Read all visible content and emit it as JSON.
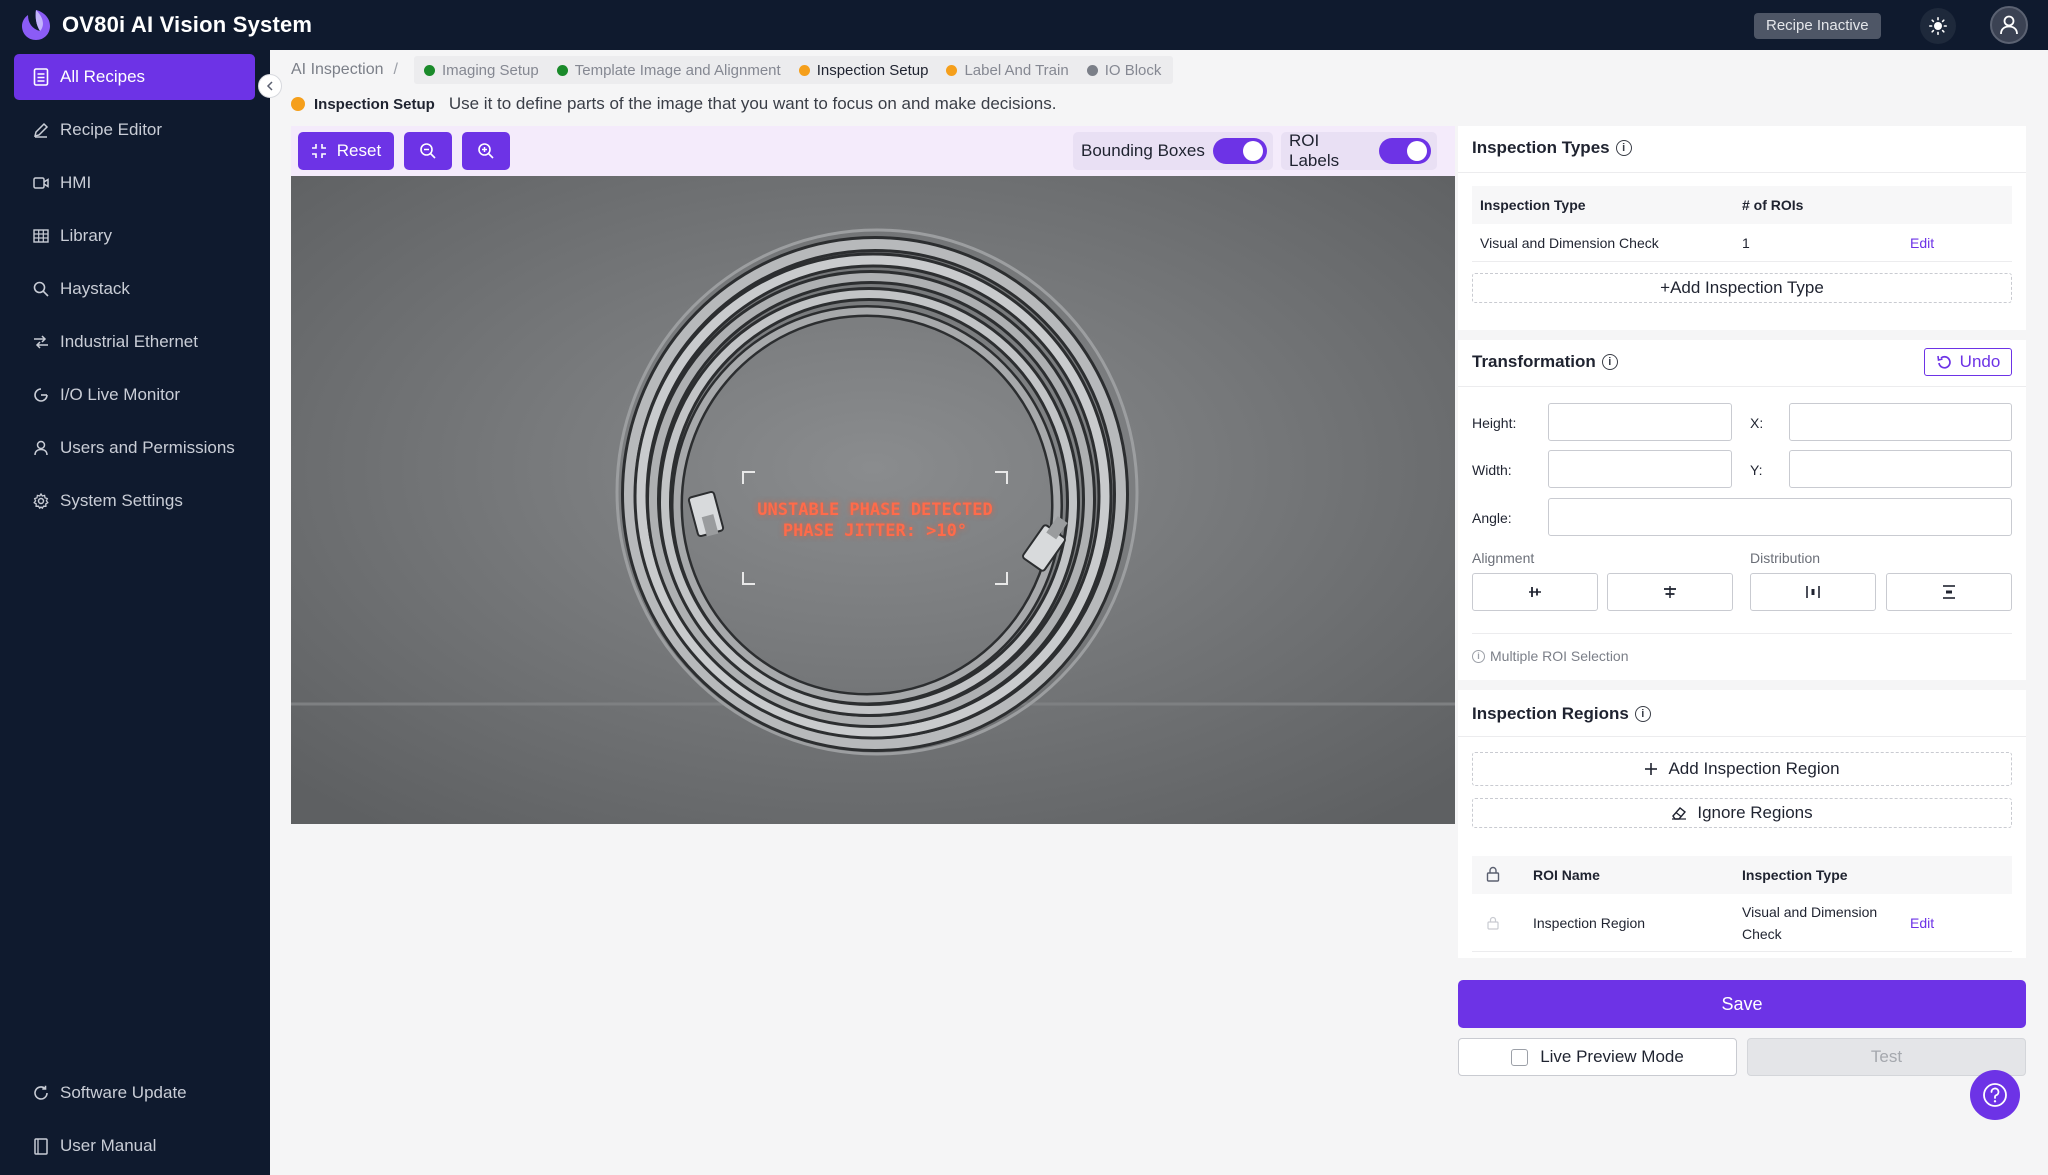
{
  "app": {
    "title": "OV80i AI Vision System",
    "recipe_status": "Recipe Inactive"
  },
  "colors": {
    "accent": "#6d33e6",
    "sidebar_bg": "#0f1a2e",
    "step_done": "#1a8a2a",
    "step_current": "#f59f1b",
    "step_pending": "#7b7f88"
  },
  "sidebar": {
    "items": [
      {
        "label": "All Recipes",
        "icon": "document-list-icon",
        "active": true
      },
      {
        "label": "Recipe Editor",
        "icon": "pencil-icon"
      },
      {
        "label": "HMI",
        "icon": "video-icon"
      },
      {
        "label": "Library",
        "icon": "grid-icon"
      },
      {
        "label": "Haystack",
        "icon": "search-icon"
      },
      {
        "label": "Industrial Ethernet",
        "icon": "network-icon"
      },
      {
        "label": "I/O Live Monitor",
        "icon": "monitor-icon"
      },
      {
        "label": "Users and Permissions",
        "icon": "user-icon"
      },
      {
        "label": "System Settings",
        "icon": "gear-icon"
      }
    ],
    "bottom": [
      {
        "label": "Software Update",
        "icon": "refresh-icon"
      },
      {
        "label": "User Manual",
        "icon": "book-icon"
      }
    ]
  },
  "breadcrumb": {
    "root": "AI Inspection",
    "separator": "/",
    "steps": [
      {
        "label": "Imaging Setup",
        "state": "done"
      },
      {
        "label": "Template Image and Alignment",
        "state": "done"
      },
      {
        "label": "Inspection Setup",
        "state": "current"
      },
      {
        "label": "Label And Train",
        "state": "current"
      },
      {
        "label": "IO Block",
        "state": "pending"
      }
    ]
  },
  "info": {
    "label": "Inspection Setup",
    "text": "Use it to define parts of the image that you want to focus on and make decisions."
  },
  "toolbar": {
    "reset_label": "Reset",
    "bounding_boxes_label": "Bounding Boxes",
    "bounding_boxes_on": true,
    "roi_labels_label": "ROI Labels",
    "roi_labels_on": true
  },
  "canvas": {
    "overlay_line1": "UNSTABLE PHASE DETECTED",
    "overlay_line2": "PHASE JITTER: >10°"
  },
  "inspection_types": {
    "title": "Inspection Types",
    "columns": [
      "Inspection Type",
      "# of ROIs"
    ],
    "rows": [
      {
        "type": "Visual and Dimension Check",
        "rois": "1",
        "action": "Edit"
      }
    ],
    "add_label": "+Add Inspection Type"
  },
  "transformation": {
    "title": "Transformation",
    "undo_label": "Undo",
    "fields": {
      "height": "Height:",
      "width": "Width:",
      "x": "X:",
      "y": "Y:",
      "angle": "Angle:"
    },
    "alignment_label": "Alignment",
    "distribution_label": "Distribution",
    "multi_roi_note": "Multiple ROI Selection"
  },
  "inspection_regions": {
    "title": "Inspection Regions",
    "add_label": "Add Inspection Region",
    "ignore_label": "Ignore Regions",
    "columns": [
      "ROI Name",
      "Inspection Type"
    ],
    "rows": [
      {
        "name": "Inspection Region",
        "type_line1": "Visual and Dimension",
        "type_line2": "Check",
        "action": "Edit"
      }
    ]
  },
  "actions": {
    "save_label": "Save",
    "live_preview_label": "Live Preview Mode",
    "test_label": "Test"
  }
}
